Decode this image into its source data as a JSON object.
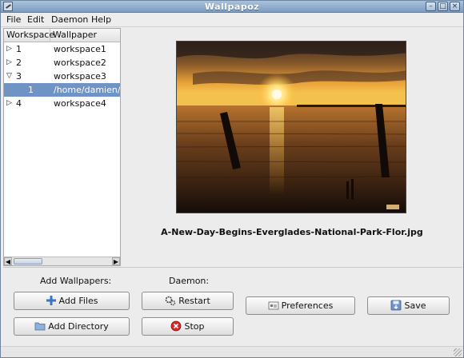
{
  "window": {
    "title": "Wallpapoz"
  },
  "menubar": {
    "items": [
      "File",
      "Edit",
      "Daemon",
      "Help"
    ]
  },
  "tree": {
    "columns": [
      "Workspace",
      "Wallpaper"
    ],
    "rows": [
      {
        "expander": "closed",
        "workspace": "1",
        "wallpaper": "workspace1"
      },
      {
        "expander": "closed",
        "workspace": "2",
        "wallpaper": "workspace2"
      },
      {
        "expander": "open",
        "workspace": "3",
        "wallpaper": "workspace3"
      },
      {
        "expander": "none",
        "workspace": "1",
        "wallpaper": "/home/damien/wa",
        "selected": true
      },
      {
        "expander": "closed",
        "workspace": "4",
        "wallpaper": "workspace4"
      }
    ]
  },
  "preview": {
    "filename": "A-New-Day-Begins-Everglades-National-Park-Flor.jpg"
  },
  "labels": {
    "add_wallpapers": "Add Wallpapers:",
    "daemon": "Daemon:"
  },
  "buttons": {
    "add_files": "Add Files",
    "add_directory": "Add Directory",
    "restart": "Restart",
    "stop": "Stop",
    "preferences": "Preferences",
    "save": "Save"
  },
  "colors": {
    "selection": "#6e93c4",
    "titlebar": "#8fadcf"
  }
}
